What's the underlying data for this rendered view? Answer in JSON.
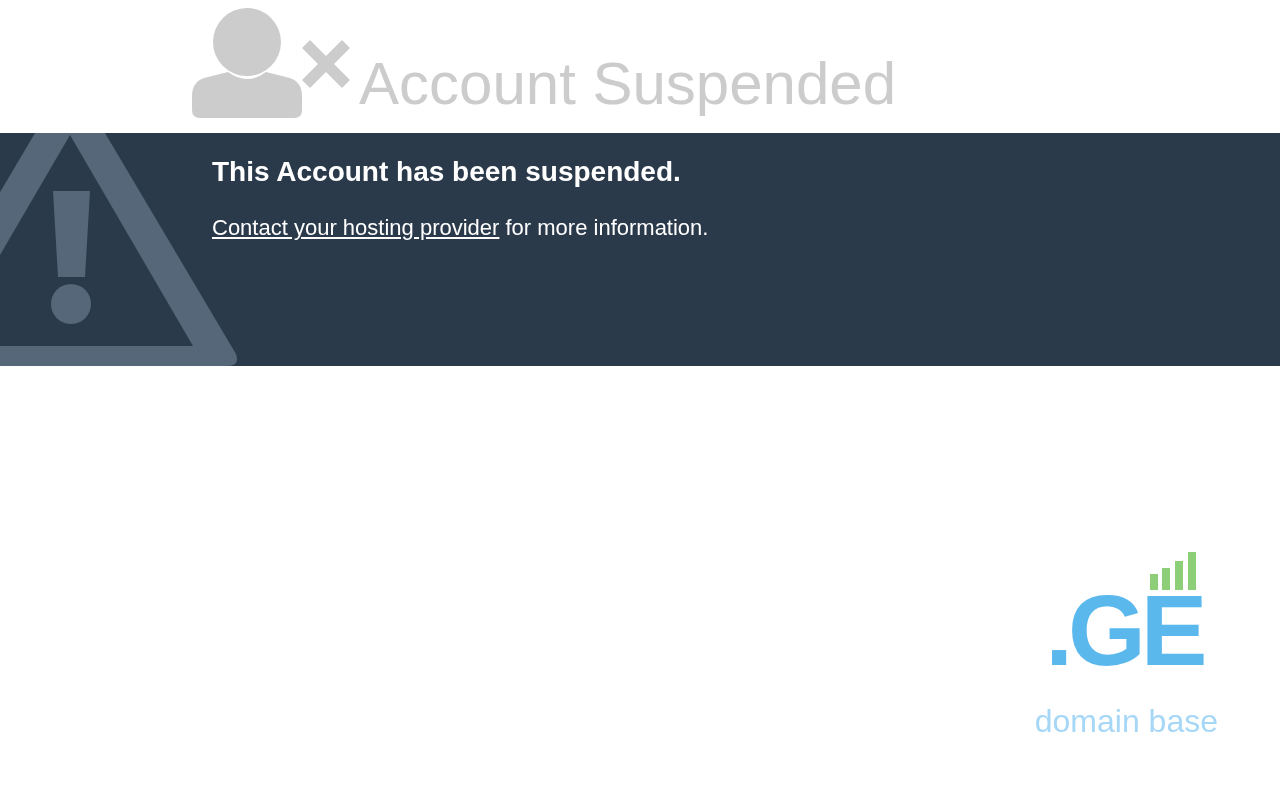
{
  "header": {
    "title": "Account Suspended"
  },
  "notice": {
    "heading": "This Account has been suspended.",
    "link": "Contact your hosting provider",
    "text": "for more information."
  },
  "logo": {
    "mark": ".GE",
    "tagline": "domain base"
  }
}
